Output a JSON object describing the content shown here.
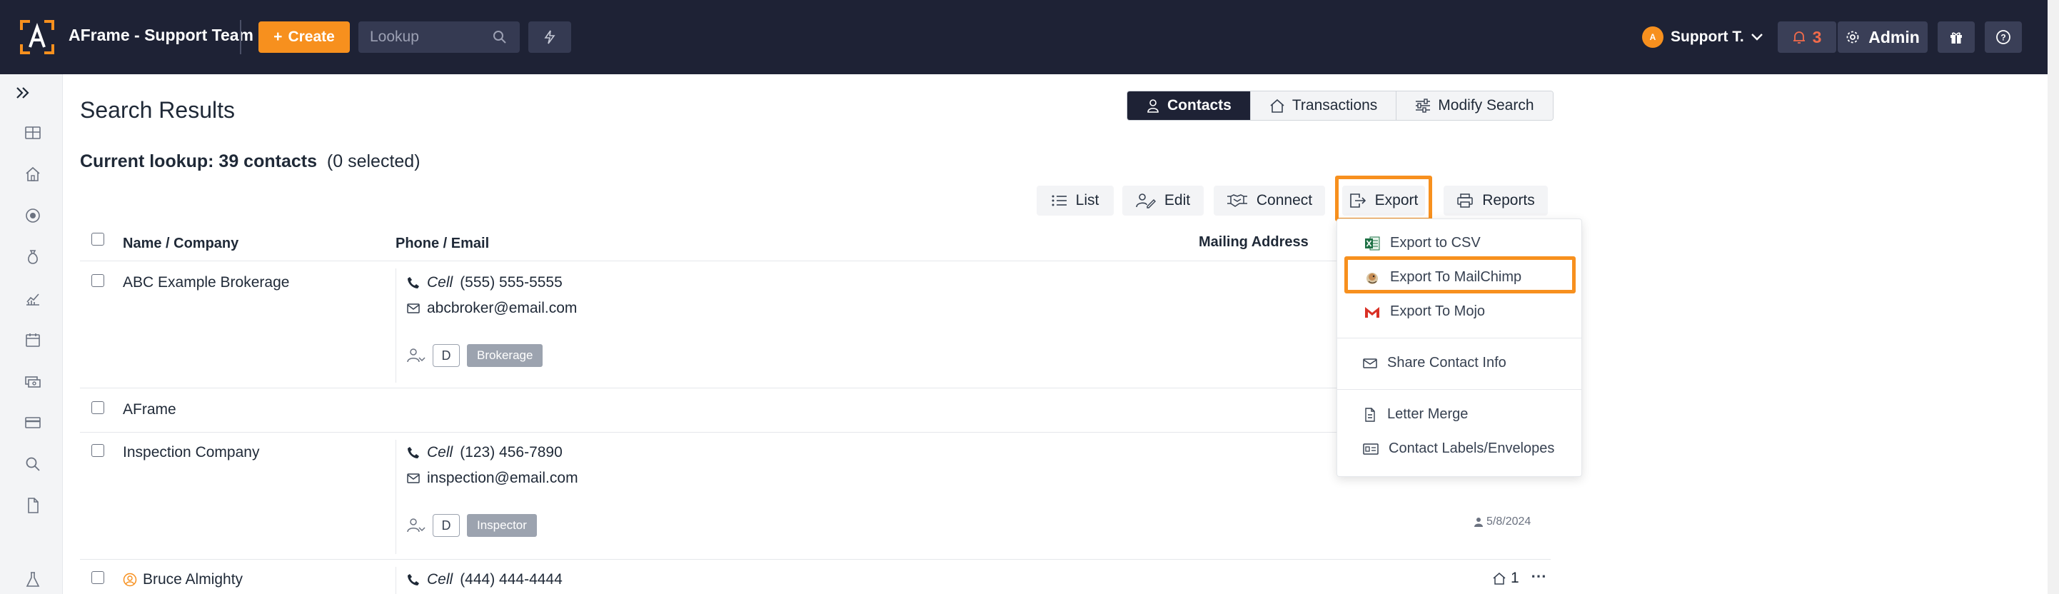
{
  "header": {
    "app_title": "AFrame - Support Team",
    "create_label": "Create",
    "lookup_placeholder": "Lookup",
    "user_name": "Support T.",
    "user_initial": "A",
    "notification_count": "3",
    "admin_label": "Admin"
  },
  "page": {
    "title": "Search Results",
    "tabs": [
      {
        "label": "Contacts",
        "icon": "person-icon",
        "active": true
      },
      {
        "label": "Transactions",
        "icon": "house-icon",
        "active": false
      },
      {
        "label": "Modify Search",
        "icon": "sliders-icon",
        "active": false
      }
    ],
    "lookup_summary": "Current lookup: 39 contacts",
    "selected_summary": "(0 selected)"
  },
  "actions": [
    {
      "label": "List",
      "icon": "list-icon"
    },
    {
      "label": "Edit",
      "icon": "edit-user-icon"
    },
    {
      "label": "Connect",
      "icon": "handshake-icon"
    },
    {
      "label": "Export",
      "icon": "export-icon"
    },
    {
      "label": "Reports",
      "icon": "printer-icon"
    }
  ],
  "table": {
    "columns": [
      "Name  /  Company",
      "Phone / Email",
      "Mailing Address"
    ],
    "rows": [
      {
        "name": "ABC Example Brokerage",
        "phone_type": "Cell",
        "phone": "(555) 555-5555",
        "email": "abcbroker@email.com",
        "tag_letter": "D",
        "tag": "Brokerage"
      },
      {
        "name": "AFrame"
      },
      {
        "name": "Inspection Company",
        "phone_type": "Cell",
        "phone": "(123) 456-7890",
        "email": "inspection@email.com",
        "tag_letter": "D",
        "tag": "Inspector",
        "date": "5/8/2024"
      },
      {
        "name": "Bruce Almighty",
        "phone_type": "Cell",
        "phone": "(444) 444-4444",
        "count": "1"
      }
    ]
  },
  "export_menu": {
    "items": [
      {
        "label": "Export to CSV",
        "icon": "excel-icon"
      },
      {
        "label": "Export To MailChimp",
        "icon": "mailchimp-icon"
      },
      {
        "label": "Export To Mojo",
        "icon": "mojo-icon"
      },
      {
        "label": "Share Contact Info",
        "icon": "envelope-icon"
      },
      {
        "label": "Letter Merge",
        "icon": "document-icon"
      },
      {
        "label": "Contact Labels/Envelopes",
        "icon": "id-card-icon"
      }
    ]
  },
  "colors": {
    "accent": "#f7901e",
    "topbar": "#1e2235",
    "notification": "#f26b4b"
  }
}
